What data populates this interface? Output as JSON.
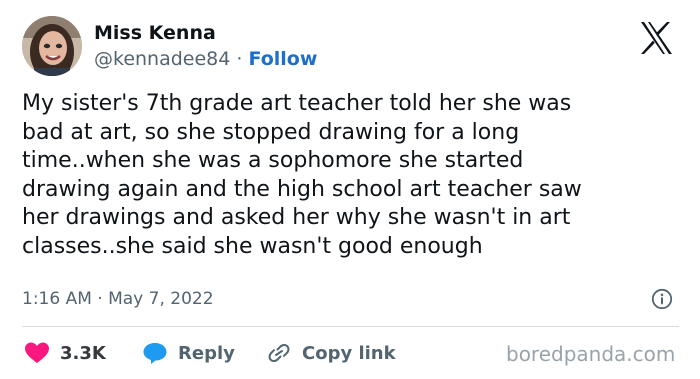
{
  "author": {
    "name": "Miss Kenna",
    "handle": "@kennadee84",
    "separator": "·",
    "follow_label": "Follow"
  },
  "tweet": {
    "lines": [
      "My sister's 7th grade art teacher told her she was",
      "bad at art, so she stopped drawing for a long",
      "time..when she was a sophomore she started",
      "drawing again and the high school art teacher saw",
      "her drawings and asked her why she wasn't in art",
      "classes..she said she wasn't good enough"
    ],
    "timestamp": "1:16 AM · May 7, 2022"
  },
  "actions": {
    "like_count": "3.3K",
    "reply_label": "Reply",
    "copy_link_label": "Copy link"
  },
  "watermark": "boredpanda.com",
  "icons": {
    "platform": "x-logo-icon",
    "info": "info-icon",
    "like": "heart-icon",
    "reply": "speech-bubble-icon",
    "copy": "link-icon"
  },
  "colors": {
    "follow": "#1d6fc9",
    "heart": "#f91880",
    "reply_bubble": "#1d9bf0",
    "text": "#0f1419",
    "muted": "#536471"
  }
}
